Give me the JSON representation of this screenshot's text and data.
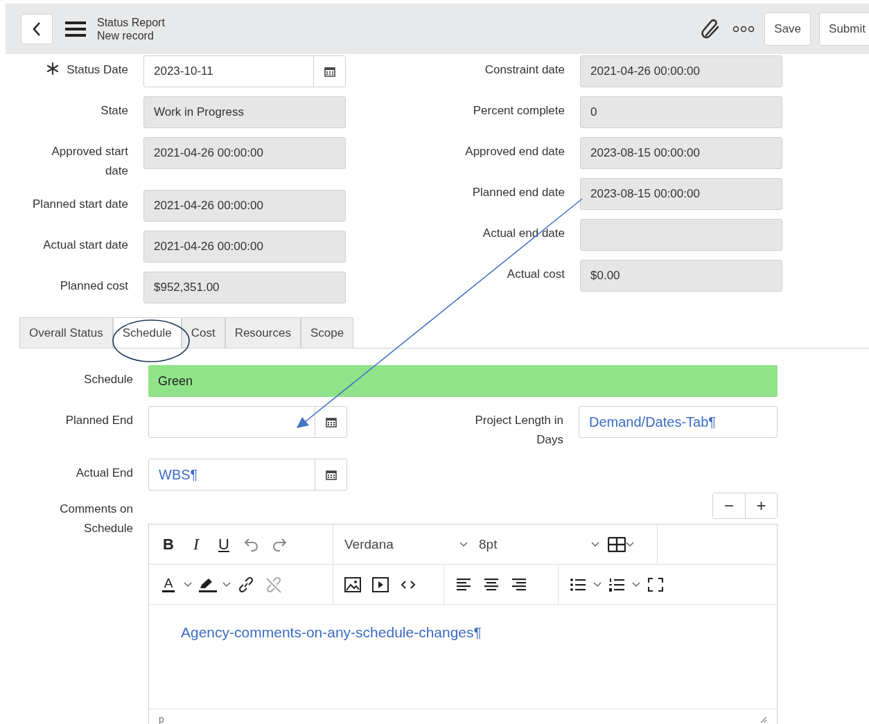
{
  "header": {
    "title": "Status Report",
    "subtitle": "New record",
    "actions": [
      {
        "label": "Save"
      },
      {
        "label": "Submit"
      }
    ]
  },
  "form": {
    "left": [
      {
        "label": "Status Date",
        "required": true,
        "wrap": false,
        "kind": "date",
        "readonly": false,
        "value": "2023-10-11"
      },
      {
        "label": "State",
        "required": false,
        "wrap": false,
        "kind": "text",
        "readonly": true,
        "value": "Work in Progress"
      },
      {
        "label": "Approved start date",
        "required": false,
        "wrap": true,
        "kind": "text",
        "readonly": true,
        "value": "2021-04-26 00:00:00"
      },
      {
        "label": "Planned start date",
        "required": false,
        "wrap": false,
        "kind": "text",
        "readonly": true,
        "value": "2021-04-26 00:00:00"
      },
      {
        "label": "Actual start date",
        "required": false,
        "wrap": false,
        "kind": "text",
        "readonly": true,
        "value": "2021-04-26 00:00:00"
      },
      {
        "label": "Planned cost",
        "required": false,
        "wrap": false,
        "kind": "text",
        "readonly": true,
        "value": "$952,351.00"
      }
    ],
    "right": [
      {
        "label": "Constraint date",
        "required": false,
        "wrap": false,
        "kind": "text",
        "readonly": true,
        "value": "2021-04-26 00:00:00"
      },
      {
        "label": "Percent complete",
        "required": false,
        "wrap": false,
        "kind": "text",
        "readonly": true,
        "value": "0"
      },
      {
        "label": "Approved end date",
        "required": false,
        "wrap": false,
        "kind": "text",
        "readonly": true,
        "value": "2023-08-15 00:00:00"
      },
      {
        "label": "Planned end date",
        "required": false,
        "wrap": false,
        "kind": "text",
        "readonly": true,
        "value": "2023-08-15 00:00:00"
      },
      {
        "label": "Actual end date",
        "required": false,
        "wrap": false,
        "kind": "text",
        "readonly": true
      },
      {
        "label": "Actual cost",
        "required": false,
        "wrap": false,
        "kind": "text",
        "readonly": true,
        "value": "$0.00"
      }
    ]
  },
  "tabs": [
    {
      "label": "Overall Status",
      "selected": false
    },
    {
      "label": "Schedule",
      "selected": true
    },
    {
      "label": "Cost",
      "selected": false
    },
    {
      "label": "Resources",
      "selected": false
    },
    {
      "label": "Scope",
      "selected": false
    }
  ],
  "schedule_tab": {
    "status": {
      "label": "Schedule",
      "value": "Green",
      "color": "#90e388"
    },
    "planned_end": {
      "label": "Planned End",
      "kind": "date"
    },
    "project_length": {
      "label": "Project Length in Days",
      "kind": "text",
      "value": "Demand/Dates-Tab¶",
      "note": true
    },
    "actual_end": {
      "label": "Actual End",
      "kind": "date",
      "value": "WBS¶",
      "note": true
    },
    "comments": {
      "label": "Comments on Schedule",
      "zoom_buttons": [
        "−",
        "+"
      ],
      "editor": {
        "format_buttons": [
          "B",
          "I",
          "U"
        ],
        "font": "Verdana",
        "size": "8pt",
        "text_color_label": "A",
        "body": "Agency-comments-on-any-schedule-changes¶",
        "note": true,
        "path": "p"
      }
    }
  },
  "annotations": {
    "arrow": true,
    "ellipse": true
  }
}
